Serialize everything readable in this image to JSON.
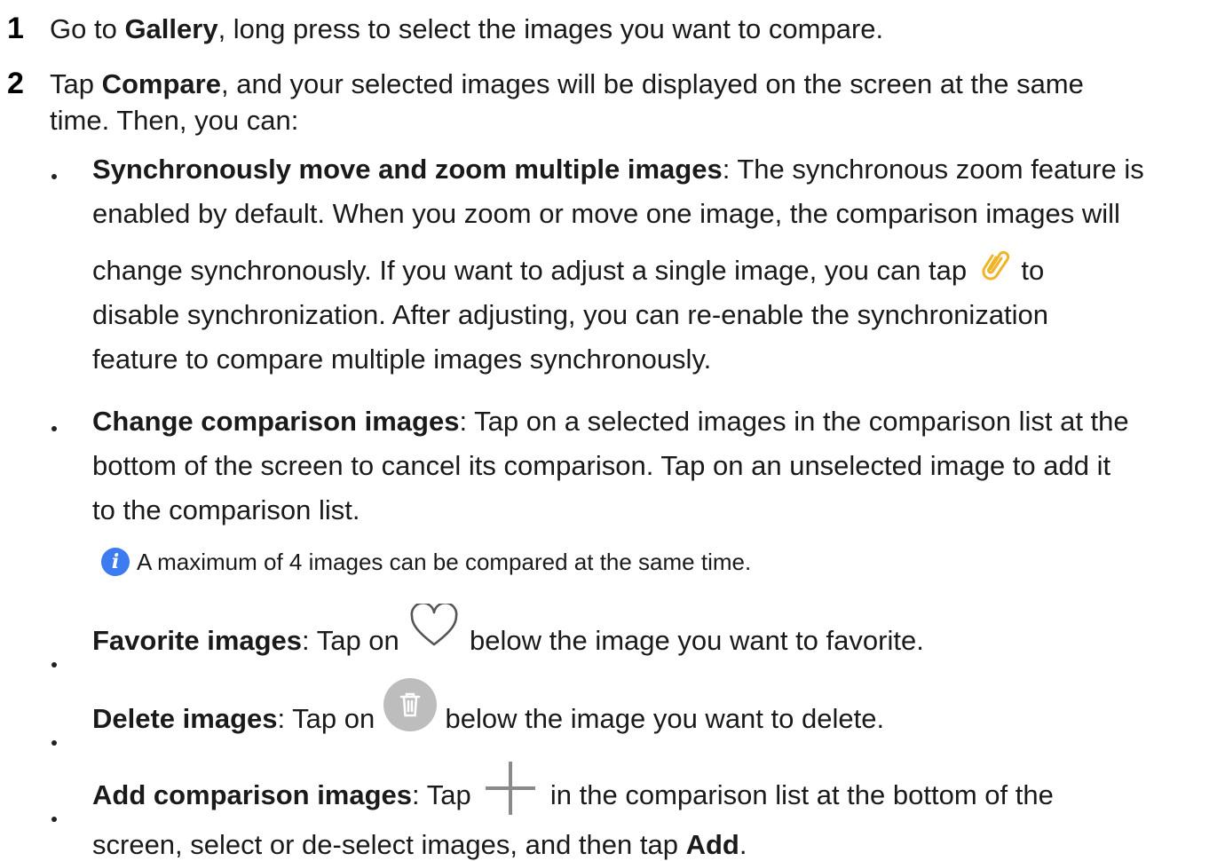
{
  "steps": [
    {
      "number": "1",
      "before": "Go to ",
      "bold": "Gallery",
      "after": ", long press to select the images you want to compare."
    },
    {
      "number": "2",
      "before": "Tap ",
      "bold": "Compare",
      "after": ", and your selected images will be displayed on the screen at the same",
      "line2": "time. Then, you can:"
    }
  ],
  "bullets": {
    "sync": {
      "title": "Synchronously move and zoom multiple images",
      "line1_rest": ": The synchronous zoom feature is",
      "line2": "enabled by default. When you zoom or move one image, the comparison images will",
      "line3_before": "change synchronously. If you want to adjust a single image, you can tap ",
      "line3_after": " to",
      "line4": "disable synchronization. After adjusting, you can re-enable the synchronization",
      "line5": "feature to compare multiple images synchronously."
    },
    "change": {
      "title": "Change comparison images",
      "line1_rest": ": Tap on a selected images in the comparison list at the",
      "line2": "bottom of the screen to cancel its comparison. Tap on an unselected image to add it",
      "line3": "to the comparison list."
    },
    "note": {
      "icon_text": "i",
      "text": "A maximum of 4 images can be compared at the same time."
    },
    "favorite": {
      "title": "Favorite images",
      "before": ": Tap on ",
      "after": " below the image you want to favorite."
    },
    "delete": {
      "title": "Delete images",
      "before": ": Tap on ",
      "after": " below the image you want to delete."
    },
    "add": {
      "title": "Add comparison images",
      "before": ": Tap ",
      "after": " in the comparison list at the bottom of the",
      "line2_before": "screen, select or de-select images, and then tap ",
      "line2_bold": "Add",
      "line2_after": "."
    }
  },
  "icons": {
    "link": "link-icon",
    "heart": "heart-icon",
    "delete": "trash-icon",
    "add": "plus-icon",
    "info": "info-icon"
  },
  "colors": {
    "link_icon": "#f0b429",
    "info_badge": "#3d7bf0",
    "trash_bg": "#bdbdbd",
    "plus": "#8a8a8a",
    "heart": "#555555"
  }
}
